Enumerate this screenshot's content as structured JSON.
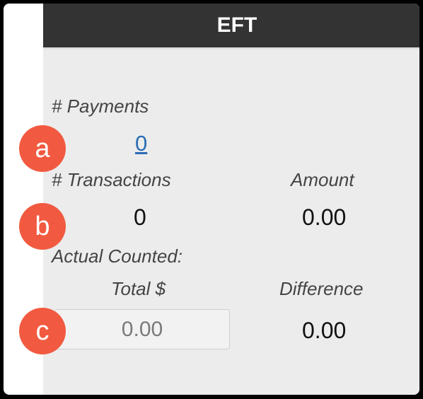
{
  "panel": {
    "title": "EFT",
    "payments_label": "# Payments",
    "payments_count": "0",
    "transactions_label": "# Transactions",
    "amount_label": "Amount",
    "transactions_count": "0",
    "amount_value": "0.00",
    "actual_counted_label": "Actual Counted:",
    "total_label": "Total $",
    "difference_label": "Difference",
    "total_input_value": "0.00",
    "difference_value": "0.00"
  },
  "annotations": [
    "a",
    "b",
    "c"
  ],
  "colors": {
    "header_bg": "#333333",
    "panel_bg": "#ececec",
    "link": "#2a6db5",
    "badge": "#f15a40"
  }
}
